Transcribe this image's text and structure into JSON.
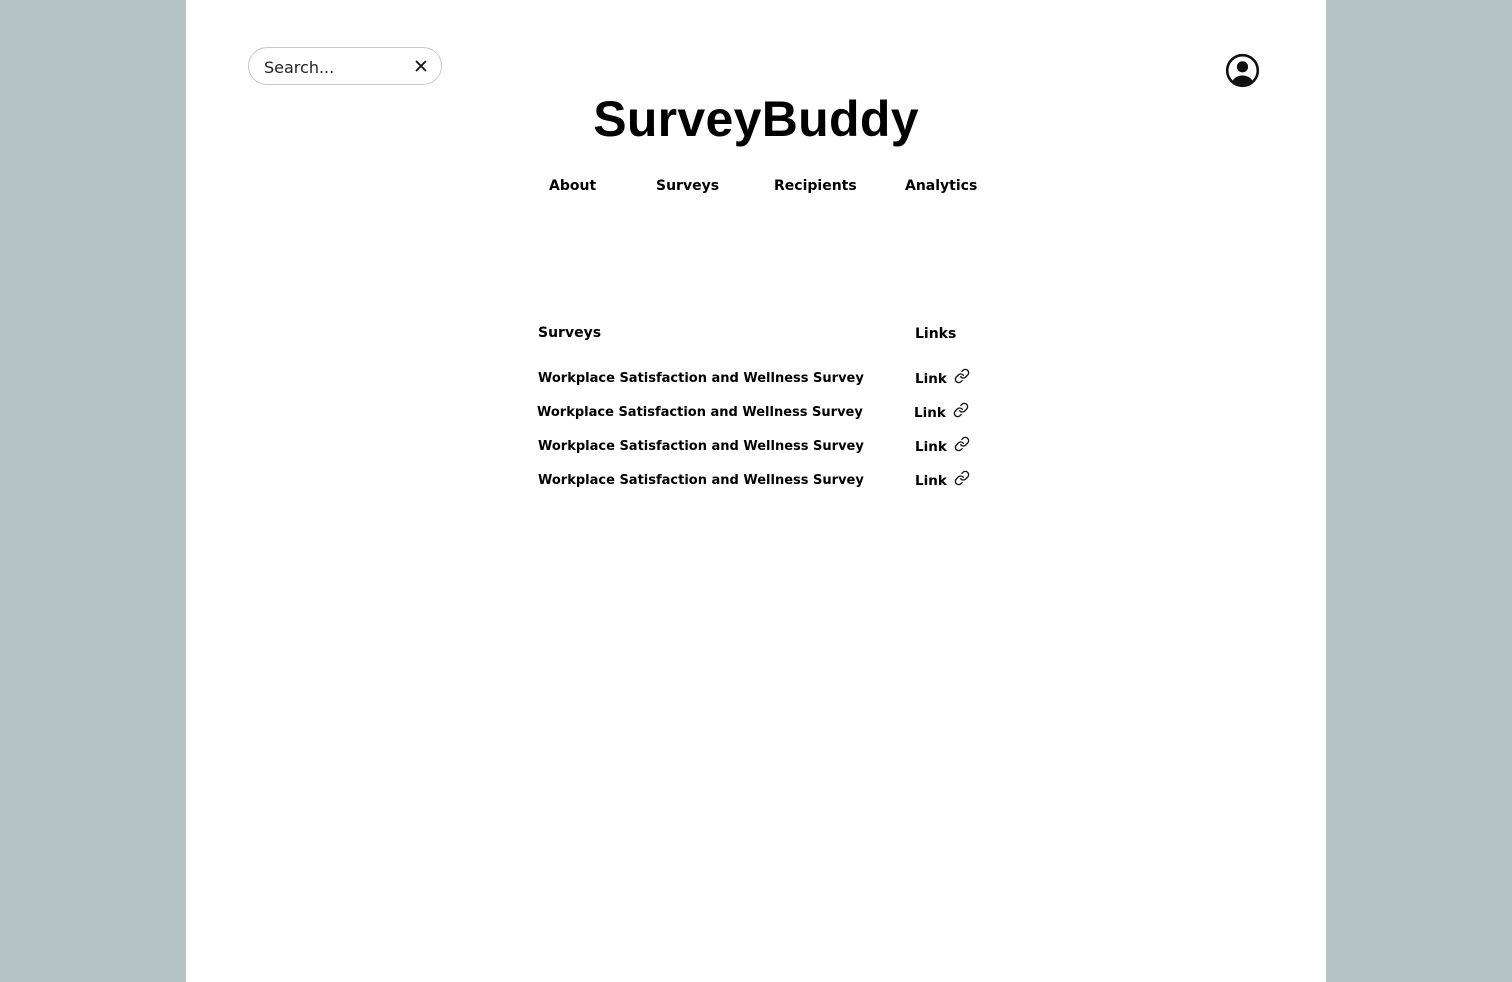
{
  "app": {
    "brand": "SurveyBuddy"
  },
  "search": {
    "placeholder": "Search..."
  },
  "nav": {
    "items": [
      {
        "label": "About"
      },
      {
        "label": "Surveys"
      },
      {
        "label": "Recipients"
      },
      {
        "label": "Analytics"
      }
    ]
  },
  "table": {
    "headers": {
      "surveys": "Surveys",
      "links": "Links"
    },
    "rows": [
      {
        "name": "Workplace Satisfaction and Wellness Survey",
        "link_label": "Link",
        "icon": "link-icon"
      },
      {
        "name": "Workplace Satisfaction and Wellness Survey",
        "link_label": "Link",
        "icon": "link-icon"
      },
      {
        "name": "Workplace Satisfaction and Wellness Survey",
        "link_label": "Link",
        "icon": "link-icon"
      },
      {
        "name": "Workplace Satisfaction and Wellness Survey",
        "link_label": "Link",
        "icon": "link-icon"
      }
    ]
  },
  "icons": {
    "clear": "close-icon",
    "account": "user-circle-icon"
  },
  "colors": {
    "outer_background": "#b5c3c4",
    "page_background": "#ffffff",
    "text": "#000000",
    "search_border": "#c8c8c8"
  }
}
